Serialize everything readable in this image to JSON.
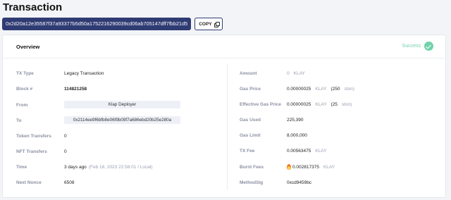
{
  "page": {
    "title": "Transaction"
  },
  "tx_hash": "0x2d20a12e35587f37a93377b5d50a1752216290039cd06ab705147dff7fbb21d5",
  "copy_label": "COPY",
  "overview": {
    "title": "Overview",
    "status": "Success"
  },
  "left": {
    "tx_type": {
      "label": "TX Type",
      "value": "Legacy Transaction"
    },
    "block": {
      "label": "Block #",
      "value": "114821258"
    },
    "from": {
      "label": "From",
      "value": "Klap Deployer"
    },
    "to": {
      "label": "To",
      "value": "0x2114ee9f6bfb8e06f9b09f7a686ebd20b25e280a"
    },
    "token_transfers": {
      "label": "Token Transfers",
      "value": "0"
    },
    "nft_transfers": {
      "label": "NFT Transfers",
      "value": "0"
    },
    "time": {
      "label": "Time",
      "value": "3 days ago",
      "detail": "(Feb 18, 2023 22:58:01 / Local)"
    },
    "next_nonce": {
      "label": "Next Nonce",
      "value": "6508"
    }
  },
  "right": {
    "amount": {
      "label": "Amount",
      "value": "0",
      "unit": "KLAY"
    },
    "gas_price": {
      "label": "Gas Price",
      "value": "0.00000025",
      "unit": "KLAY",
      "extra_open": "(250",
      "extra_unit": "ston)"
    },
    "effective_gas_price": {
      "label": "Effective Gas Price",
      "value": "0.00000025",
      "unit": "KLAY",
      "extra_open": "(25",
      "extra_unit": "ston)"
    },
    "gas_used": {
      "label": "Gas Used",
      "value": "225,390"
    },
    "gas_limit": {
      "label": "Gas Limit",
      "value": "8,000,000"
    },
    "tx_fee": {
      "label": "TX Fee",
      "value": "0.00563475",
      "unit": "KLAY"
    },
    "burnt_fees": {
      "label": "Burnt Fees",
      "value": "0.002817375",
      "unit": "KLAY"
    },
    "method_sig": {
      "label": "MethodSig",
      "value": "0xcd9459bc"
    }
  },
  "colors": {
    "hash_bg": "#2f3b73",
    "success": "#6fd2aa",
    "label": "#8c90a3"
  }
}
